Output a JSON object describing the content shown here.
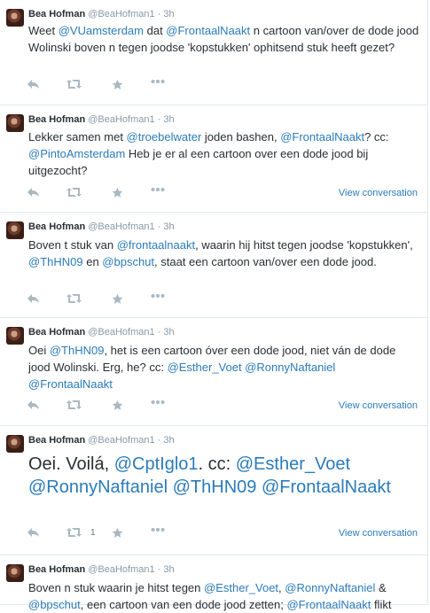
{
  "tweets": [
    {
      "name": "Bea Hofman",
      "handle": "@BeaHofman1",
      "time": "3h",
      "big": false,
      "segments": [
        {
          "t": "Weet ",
          "m": false
        },
        {
          "t": "@VUamsterdam",
          "m": true
        },
        {
          "t": " dat ",
          "m": false
        },
        {
          "t": "@FrontaalNaakt",
          "m": true
        },
        {
          "t": " n cartoon van/over de dode jood Wolinski boven n tegen joodse 'kopstukken' ophitsend stuk heeft gezet?",
          "m": false
        }
      ],
      "retweet_count": "",
      "view_conversation": ""
    },
    {
      "name": "Bea Hofman",
      "handle": "@BeaHofman1",
      "time": "3h",
      "big": false,
      "segments": [
        {
          "t": "Lekker samen met ",
          "m": false
        },
        {
          "t": "@troebelwater",
          "m": true
        },
        {
          "t": " joden bashen, ",
          "m": false
        },
        {
          "t": "@FrontaalNaakt",
          "m": true
        },
        {
          "t": "? cc: ",
          "m": false
        },
        {
          "t": "@PintoAmsterdam",
          "m": true
        },
        {
          "t": " Heb je er al een cartoon over een dode jood bij uitgezocht?",
          "m": false
        }
      ],
      "retweet_count": "",
      "view_conversation": "View conversation"
    },
    {
      "name": "Bea Hofman",
      "handle": "@BeaHofman1",
      "time": "3h",
      "big": false,
      "segments": [
        {
          "t": "Boven t stuk van ",
          "m": false
        },
        {
          "t": "@frontaalnaakt",
          "m": true
        },
        {
          "t": ", waarin hij hitst tegen joodse 'kopstukken', ",
          "m": false
        },
        {
          "t": "@ThHN09",
          "m": true
        },
        {
          "t": " en ",
          "m": false
        },
        {
          "t": "@bpschut",
          "m": true
        },
        {
          "t": ", staat een cartoon van/over een dode jood.",
          "m": false
        }
      ],
      "retweet_count": "",
      "view_conversation": ""
    },
    {
      "name": "Bea Hofman",
      "handle": "@BeaHofman1",
      "time": "3h",
      "big": false,
      "segments": [
        {
          "t": "Oei ",
          "m": false
        },
        {
          "t": "@ThHN09",
          "m": true
        },
        {
          "t": ", het is een cartoon óver een dode jood, niet ván de dode jood Wolinski. Erg, he? cc: ",
          "m": false
        },
        {
          "t": "@Esther_Voet",
          "m": true
        },
        {
          "t": " ",
          "m": false
        },
        {
          "t": "@RonnyNaftaniel",
          "m": true
        },
        {
          "t": " ",
          "m": false
        },
        {
          "t": "@FrontaalNaakt",
          "m": true
        }
      ],
      "retweet_count": "",
      "view_conversation": "View conversation"
    },
    {
      "name": "Bea Hofman",
      "handle": "@BeaHofman1",
      "time": "3h",
      "big": true,
      "segments": [
        {
          "t": "Oei. Voilá, ",
          "m": false
        },
        {
          "t": "@CptIglo1",
          "m": true
        },
        {
          "t": ". cc: ",
          "m": false
        },
        {
          "t": "@Esther_Voet",
          "m": true
        },
        {
          "t": " ",
          "m": false
        },
        {
          "t": "@RonnyNaftaniel",
          "m": true
        },
        {
          "t": " ",
          "m": false
        },
        {
          "t": "@ThHN09",
          "m": true
        },
        {
          "t": " ",
          "m": false
        },
        {
          "t": "@FrontaalNaakt",
          "m": true
        }
      ],
      "retweet_count": "1",
      "view_conversation": "View conversation"
    },
    {
      "name": "Bea Hofman",
      "handle": "@BeaHofman1",
      "time": "3h",
      "big": false,
      "segments": [
        {
          "t": "Boven n stuk waarin je hitst tegen ",
          "m": false
        },
        {
          "t": "@Esther_Voet",
          "m": true
        },
        {
          "t": ", ",
          "m": false
        },
        {
          "t": "@RonnyNaftaniel",
          "m": true
        },
        {
          "t": " & ",
          "m": false
        },
        {
          "t": "@bpschut",
          "m": true
        },
        {
          "t": ", een cartoon van een dode jood zetten; ",
          "m": false
        },
        {
          "t": "@FrontaalNaakt",
          "m": true
        },
        {
          "t": " flikt",
          "m": false
        }
      ],
      "retweet_count": "",
      "view_conversation": ""
    }
  ],
  "icons": {
    "reply": "reply-icon",
    "retweet": "retweet-icon",
    "favorite": "star-icon",
    "more": "more-icon"
  },
  "colors": {
    "link": "#2b7bb9",
    "icon": "#aab8c2",
    "muted": "#8899a6"
  }
}
